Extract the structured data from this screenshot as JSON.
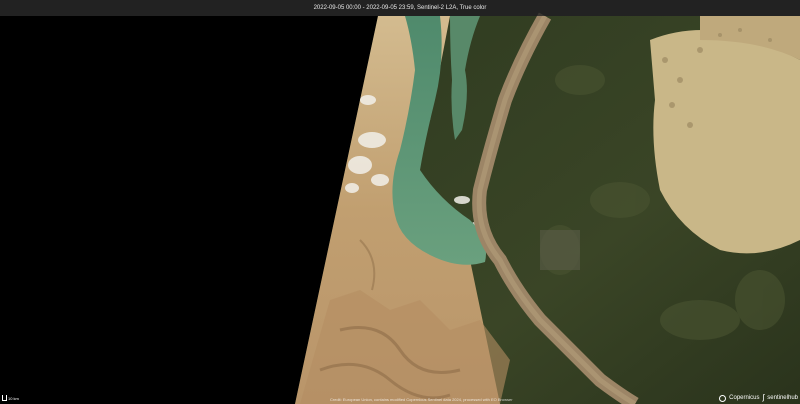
{
  "header": {
    "title": "2022-09-05 00:00 - 2022-09-05 23:59, Sentinel-2 L2A, True color"
  },
  "scale": {
    "label": "10 km"
  },
  "attribution": {
    "text": "Credit: European Union, contains modified Copernicus Sentinel data 2024, processed with EO Browser"
  },
  "logos": {
    "copernicus": "Copernicus",
    "sentinelhub": "sentinelhub"
  },
  "colors": {
    "desert": "#c9ae82",
    "desert_dark": "#a88b5f",
    "water": "#5f9a78",
    "river": "#9a8466",
    "vegetation": "#2f3a1f",
    "floodplain": "#c8b78c"
  }
}
